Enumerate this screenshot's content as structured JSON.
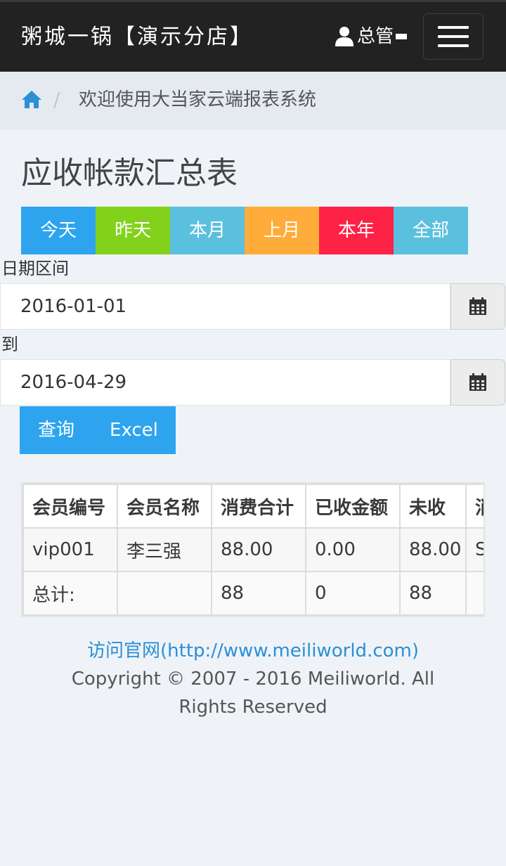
{
  "header": {
    "brand": "粥城一锅【演示分店】",
    "user_label": "总管"
  },
  "breadcrumb": {
    "text": "欢迎使用大当家云端报表系统"
  },
  "page": {
    "title": "应收帐款汇总表"
  },
  "range_buttons": [
    {
      "label": "今天",
      "color": "#2ea4ef"
    },
    {
      "label": "昨天",
      "color": "#82d21c"
    },
    {
      "label": "本月",
      "color": "#5bc0de"
    },
    {
      "label": "上月",
      "color": "#ffac3a"
    },
    {
      "label": "本年",
      "color": "#ff2247"
    },
    {
      "label": "全部",
      "color": "#5bc0de"
    }
  ],
  "filters": {
    "date_range_label": "日期区间",
    "start_date": "2016-01-01",
    "to_label": "到",
    "end_date": "2016-04-29"
  },
  "actions": {
    "query_label": "查询",
    "excel_label": "Excel"
  },
  "table": {
    "headers": [
      "会员编号",
      "会员名称",
      "消费合计",
      "已收金额",
      "未收",
      "消"
    ],
    "rows": [
      [
        "vip001",
        "李三强",
        "88.00",
        "0.00",
        "88.00",
        "S"
      ]
    ],
    "total_row": [
      "总计:",
      "",
      "88",
      "0",
      "88",
      ""
    ]
  },
  "footer": {
    "link_text": "访问官网(http://www.meiliworld.com)",
    "copyright": "Copyright © 2007 - 2016 Meiliworld. All Rights Reserved"
  }
}
